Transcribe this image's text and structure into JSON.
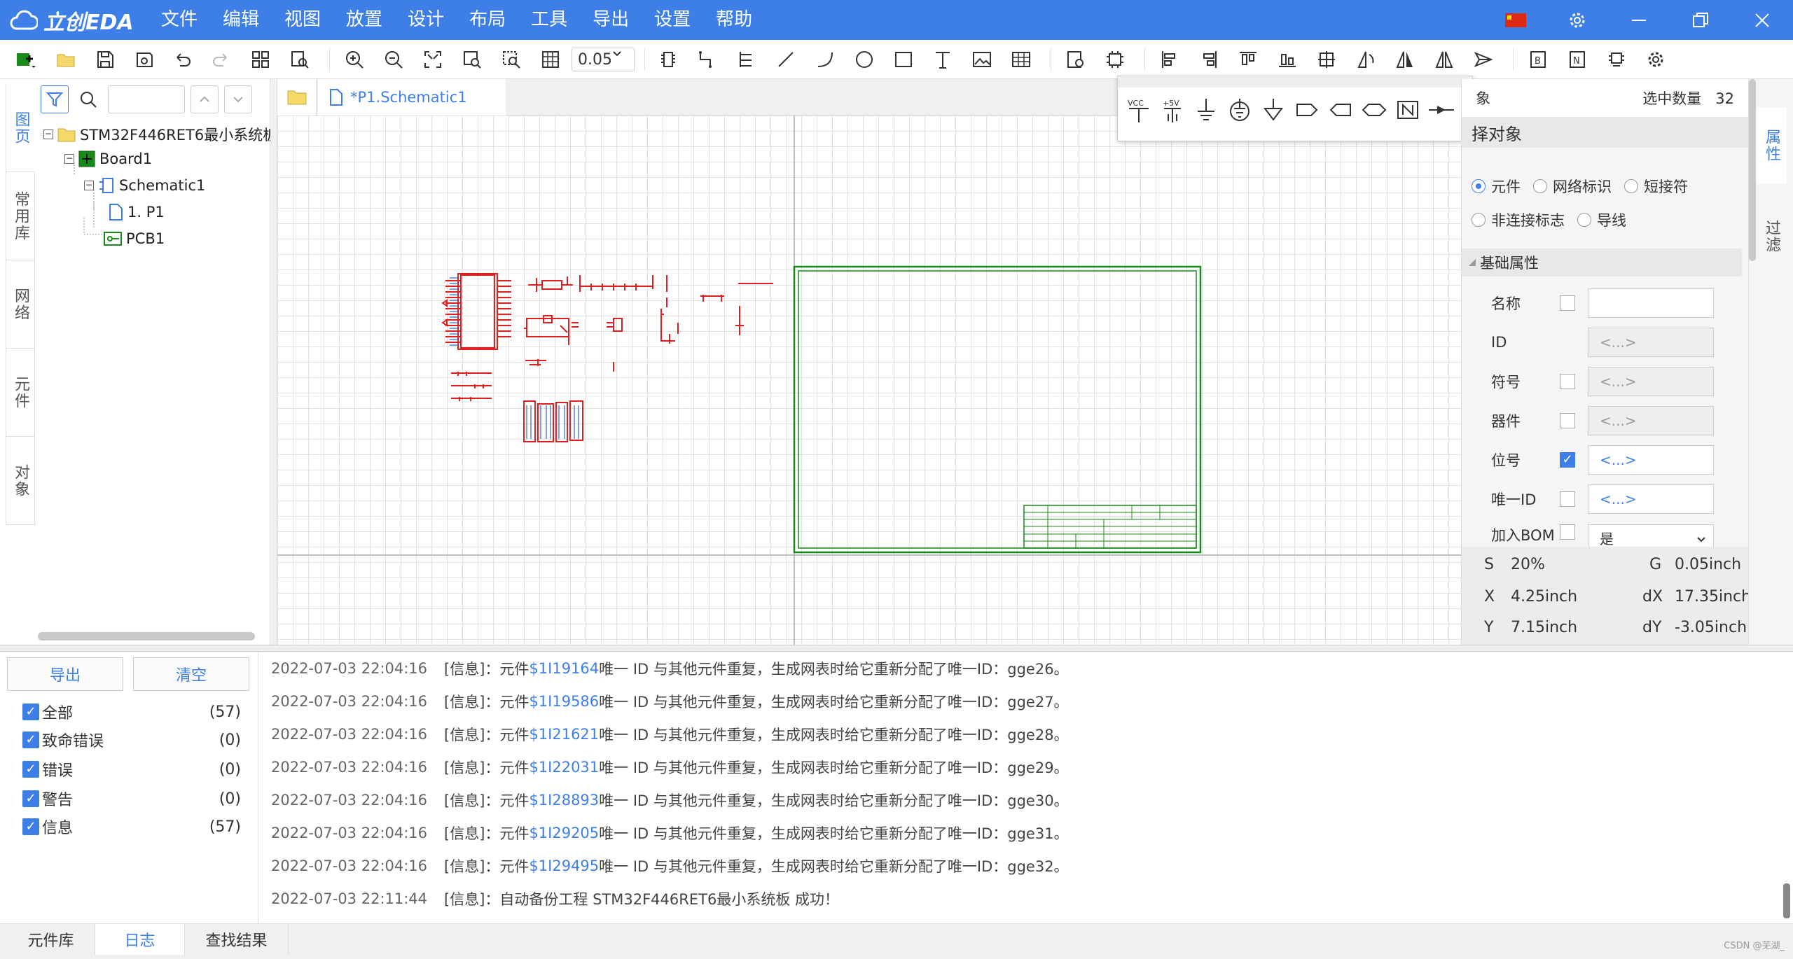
{
  "app": {
    "logo": "立创EDA",
    "menu": [
      "文件",
      "编辑",
      "视图",
      "放置",
      "设计",
      "布局",
      "工具",
      "导出",
      "设置",
      "帮助"
    ]
  },
  "toolbar": {
    "zoom": "0.05"
  },
  "left_tabs": [
    "图页",
    "常用库",
    "网络",
    "元件",
    "对象"
  ],
  "tree": {
    "project": "STM32F446RET6最小系统板",
    "board": "Board1",
    "schematic": "Schematic1",
    "page": "1. P1",
    "pcb": "PCB1"
  },
  "editor": {
    "tab": "*P1.Schematic1"
  },
  "power_toolbar": [
    "VCC",
    "+5V",
    "gnd-icon",
    "ground-circle-icon",
    "down-arrow-icon",
    "net-port-out-icon",
    "net-port-in-icon",
    "net-port-bi-icon",
    "no-connect-N-icon",
    "short-circuit-icon",
    "close-icon"
  ],
  "right": {
    "header_left": "象",
    "selected_label": "选中数量",
    "selected_count": "32",
    "section": "择对象",
    "radios": [
      {
        "label": "元件",
        "on": true
      },
      {
        "label": "网络标识",
        "on": false
      },
      {
        "label": "短接符",
        "on": false
      },
      {
        "label": "非连接标志",
        "on": false
      },
      {
        "label": "导线",
        "on": false
      }
    ],
    "basic": "基础属性",
    "props": [
      {
        "label": "名称",
        "checked": false,
        "value": "",
        "style": "normal"
      },
      {
        "label": "ID",
        "checked": null,
        "value": "<...>",
        "style": "dis"
      },
      {
        "label": "符号",
        "checked": false,
        "value": "<...>",
        "style": "dis"
      },
      {
        "label": "器件",
        "checked": false,
        "value": "<...>",
        "style": "dis"
      },
      {
        "label": "位号",
        "checked": true,
        "value": "<...>",
        "style": "blue"
      },
      {
        "label": "唯一ID",
        "checked": false,
        "value": "<...>",
        "style": "blue"
      },
      {
        "label": "加入BOM",
        "checked": false,
        "value": "是",
        "style": "select"
      }
    ],
    "coords": {
      "s_label": "S",
      "s": "20%",
      "g_label": "G",
      "g": "0.05inch",
      "x_label": "X",
      "x": "4.25inch",
      "dx_label": "dX",
      "dx": "17.35inch",
      "y_label": "Y",
      "y": "7.15inch",
      "dy_label": "dY",
      "dy": "-3.05inch"
    }
  },
  "right_tabs": [
    "属性",
    "过滤"
  ],
  "log": {
    "export": "导出",
    "clear": "清空",
    "filters": [
      {
        "label": "全部",
        "count": "(57)"
      },
      {
        "label": "致命错误",
        "count": "(0)"
      },
      {
        "label": "错误",
        "count": "(0)"
      },
      {
        "label": "警告",
        "count": "(0)"
      },
      {
        "label": "信息",
        "count": "(57)"
      }
    ],
    "lines": [
      {
        "ts": "2022-07-03 22:04:16",
        "pre": "[信息]：元件 ",
        "link": "$1I19164",
        "post": " 唯一 ID 与其他元件重复，生成网表时给它重新分配了唯一ID：gge26。"
      },
      {
        "ts": "2022-07-03 22:04:16",
        "pre": "[信息]：元件 ",
        "link": "$1I19586",
        "post": " 唯一 ID 与其他元件重复，生成网表时给它重新分配了唯一ID：gge27。"
      },
      {
        "ts": "2022-07-03 22:04:16",
        "pre": "[信息]：元件 ",
        "link": "$1I21621",
        "post": " 唯一 ID 与其他元件重复，生成网表时给它重新分配了唯一ID：gge28。"
      },
      {
        "ts": "2022-07-03 22:04:16",
        "pre": "[信息]：元件 ",
        "link": "$1I22031",
        "post": " 唯一 ID 与其他元件重复，生成网表时给它重新分配了唯一ID：gge29。"
      },
      {
        "ts": "2022-07-03 22:04:16",
        "pre": "[信息]：元件 ",
        "link": "$1I28893",
        "post": " 唯一 ID 与其他元件重复，生成网表时给它重新分配了唯一ID：gge30。"
      },
      {
        "ts": "2022-07-03 22:04:16",
        "pre": "[信息]：元件 ",
        "link": "$1I29205",
        "post": " 唯一 ID 与其他元件重复，生成网表时给它重新分配了唯一ID：gge31。"
      },
      {
        "ts": "2022-07-03 22:04:16",
        "pre": "[信息]：元件 ",
        "link": "$1I29495",
        "post": " 唯一 ID 与其他元件重复，生成网表时给它重新分配了唯一ID：gge32。"
      },
      {
        "ts": "2022-07-03 22:11:44",
        "pre": "[信息]：自动备份工程 STM32F446RET6最小系统板 成功！",
        "link": "",
        "post": ""
      }
    ]
  },
  "bottom_tabs": [
    "元件库",
    "日志",
    "查找结果"
  ],
  "watermark": "CSDN @芜湖_",
  "colors": {
    "accent": "#3d7fe6",
    "schematic": "#e02020",
    "frame": "#1a8a1a"
  }
}
